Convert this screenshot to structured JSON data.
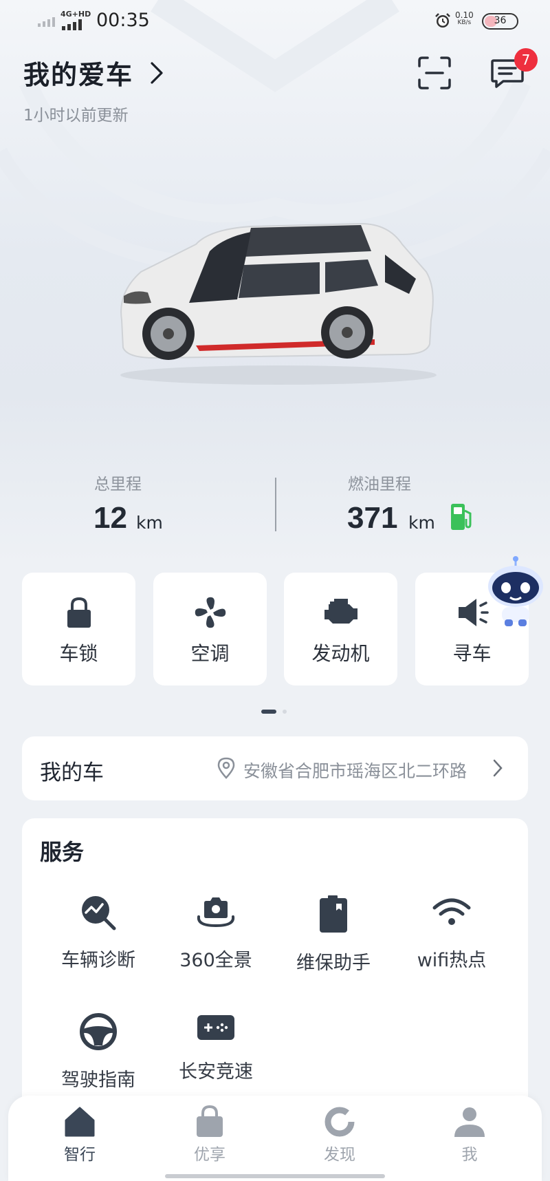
{
  "status_bar": {
    "network": "4G+HD",
    "time": "00:35",
    "net_speed_value": "0.10",
    "net_speed_unit": "KB/s",
    "battery": "36",
    "battery_fraction": 0.36
  },
  "header": {
    "title": "我的爱车",
    "updated": "1小时以前更新",
    "message_count": "7"
  },
  "mileage": {
    "total_label": "总里程",
    "total_value": "12",
    "total_unit": "km",
    "fuel_label": "燃油里程",
    "fuel_value": "371",
    "fuel_unit": "km"
  },
  "quick_controls": [
    {
      "label": "车锁",
      "icon": "lock-icon"
    },
    {
      "label": "空调",
      "icon": "fan-icon"
    },
    {
      "label": "发动机",
      "icon": "engine-icon"
    },
    {
      "label": "寻车",
      "icon": "horn-icon"
    }
  ],
  "pager": {
    "pages": 2,
    "active": 1
  },
  "my_car": {
    "title": "我的车",
    "location": "安徽省合肥市瑶海区北二环路"
  },
  "services": {
    "title": "服务",
    "items": [
      {
        "label": "车辆诊断",
        "icon": "diagnosis-icon"
      },
      {
        "label": "360全景",
        "icon": "panorama-camera-icon"
      },
      {
        "label": "维保助手",
        "icon": "maintenance-icon"
      },
      {
        "label": "wifi热点",
        "icon": "wifi-icon"
      },
      {
        "label": "驾驶指南",
        "icon": "steering-wheel-icon"
      },
      {
        "label": "长安竞速",
        "icon": "gamepad-icon"
      }
    ]
  },
  "bottom_nav": {
    "items": [
      {
        "label": "智行",
        "icon": "home-icon",
        "active": true
      },
      {
        "label": "优享",
        "icon": "bag-icon",
        "active": false
      },
      {
        "label": "发现",
        "icon": "discover-icon",
        "active": false
      },
      {
        "label": "我",
        "icon": "profile-icon",
        "active": false
      }
    ]
  },
  "colors": {
    "active_nav": "#3a4656",
    "inactive_nav": "#9ea4ad",
    "badge": "#ee2f3e",
    "fuel_icon": "#3bc15a",
    "icon_dark": "#353f4c"
  }
}
